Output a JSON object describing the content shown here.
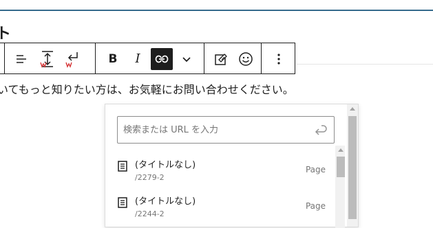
{
  "heading": {
    "fragment": "ト"
  },
  "toolbar": {
    "bold_label": "B",
    "italic_label": "I",
    "icons": [
      "align-icon",
      "line-height-icon",
      "break-icon",
      "bold",
      "italic",
      "link-icon",
      "chevron-down-icon",
      "highlight-icon",
      "emoji-icon",
      "more-options-icon"
    ]
  },
  "paragraph": {
    "text": "いてもっと知りたい方は、お気軽にお問い合わせください。"
  },
  "link_popover": {
    "search": {
      "placeholder": "検索または URL を入力",
      "value": ""
    },
    "results": [
      {
        "title": "(タイトルなし)",
        "url": "/2279-2",
        "type": "Page"
      },
      {
        "title": "(タイトルなし)",
        "url": "/2244-2",
        "type": "Page"
      }
    ]
  },
  "colors": {
    "accent_line": "#356a8c",
    "toolbar_border": "#1e1e1e",
    "active_button": "#1e1e1e",
    "red_marker": "#d63638"
  }
}
